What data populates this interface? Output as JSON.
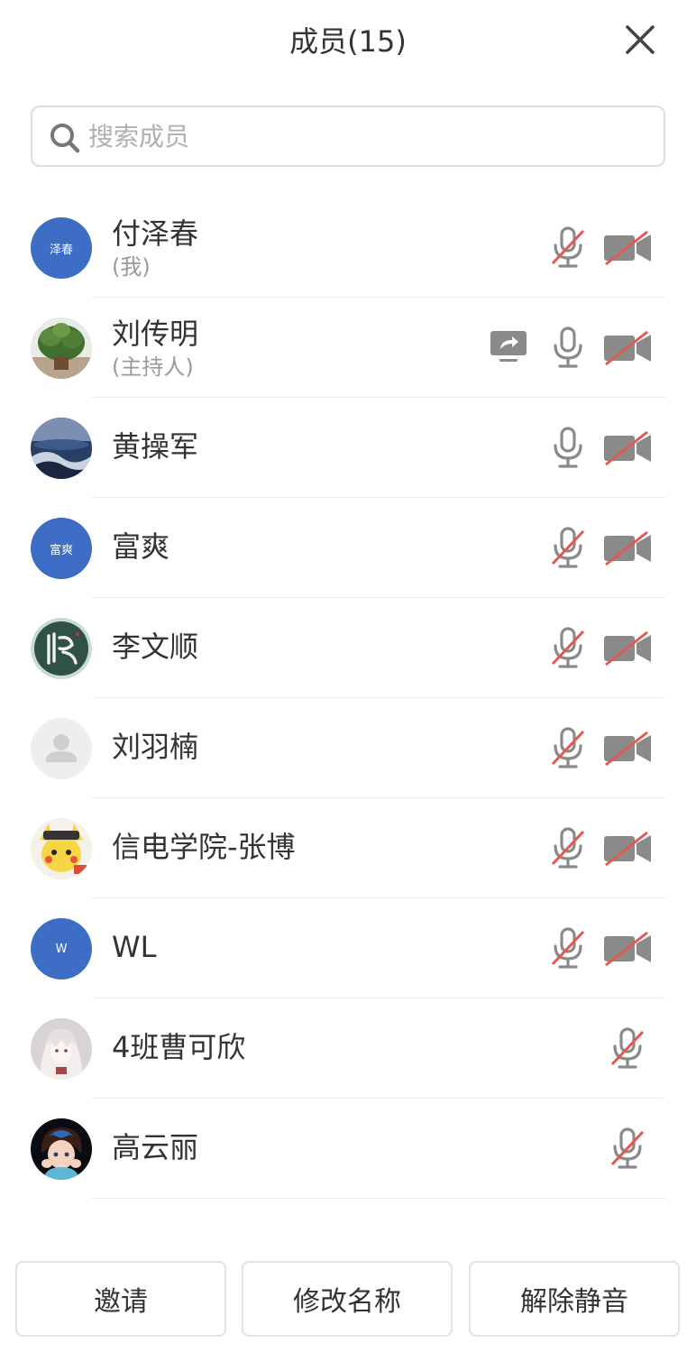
{
  "header": {
    "title": "成员(15)"
  },
  "search": {
    "placeholder": "搜索成员"
  },
  "members": [
    {
      "name": "付泽春",
      "role": "(我)",
      "avatar_text": "泽春",
      "mic": "muted",
      "camera": "off"
    },
    {
      "name": "刘传明",
      "role": "(主持人)",
      "mic": "on",
      "camera": "off",
      "sharing": true
    },
    {
      "name": "黄操军",
      "mic": "on",
      "camera": "off"
    },
    {
      "name": "富爽",
      "avatar_text": "富爽",
      "mic": "muted",
      "camera": "off"
    },
    {
      "name": "李文顺",
      "mic": "muted",
      "camera": "off"
    },
    {
      "name": "刘羽楠",
      "mic": "muted",
      "camera": "off"
    },
    {
      "name": "信电学院-张博",
      "mic": "muted",
      "camera": "off"
    },
    {
      "name": "WL",
      "avatar_text": "W",
      "mic": "muted",
      "camera": "off"
    },
    {
      "name": "4班曹可欣",
      "mic": "muted"
    },
    {
      "name": "高云丽",
      "mic": "muted"
    }
  ],
  "footer": {
    "invite_label": "邀请",
    "rename_label": "修改名称",
    "unmute_label": "解除静音"
  },
  "colors": {
    "avatar_blue": "#3d6dc4",
    "muted_red": "#e05a4f",
    "icon_gray": "#8a8a8a"
  }
}
